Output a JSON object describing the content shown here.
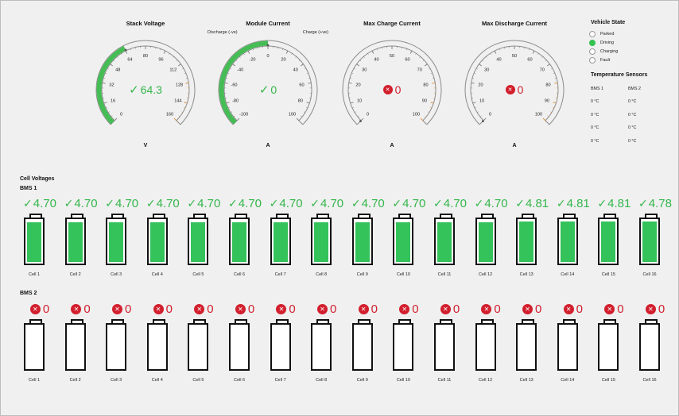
{
  "gauges": [
    {
      "key": "stack",
      "title": "Stack Voltage",
      "unit": "V",
      "min": 0,
      "max": 160,
      "ticks": [
        0,
        16,
        32,
        48,
        64,
        80,
        96,
        112,
        128,
        144,
        160
      ],
      "value": 64.3,
      "value_text": "64.3",
      "status": "ok",
      "sub_left": "",
      "sub_right": ""
    },
    {
      "key": "module",
      "title": "Module Current",
      "unit": "A",
      "min": -100,
      "max": 100,
      "ticks": [
        -100,
        -80,
        -60,
        -40,
        -20,
        0,
        20,
        40,
        60,
        80,
        100
      ],
      "value": 0,
      "value_text": "0",
      "status": "ok",
      "sub_left": "Discharge (-ve)",
      "sub_right": "Charge (+ve)"
    },
    {
      "key": "maxcharge",
      "title": "Max Charge Current",
      "unit": "A",
      "min": 0,
      "max": 100,
      "ticks": [
        0,
        10,
        20,
        30,
        40,
        50,
        60,
        70,
        80,
        90,
        100
      ],
      "value": 0,
      "value_text": "0",
      "status": "error",
      "sub_left": "",
      "sub_right": ""
    },
    {
      "key": "maxdischarge",
      "title": "Max Discharge Current",
      "unit": "A",
      "min": 0,
      "max": 100,
      "ticks": [
        0,
        10,
        20,
        30,
        40,
        50,
        60,
        70,
        80,
        90,
        100
      ],
      "value": 0,
      "value_text": "0",
      "status": "error",
      "sub_left": "",
      "sub_right": ""
    }
  ],
  "vehicle_state": {
    "title": "Vehicle State",
    "options": [
      {
        "label": "Parked",
        "selected": false
      },
      {
        "label": "Driving",
        "selected": true
      },
      {
        "label": "Charging",
        "selected": false
      },
      {
        "label": "Fault",
        "selected": false
      }
    ]
  },
  "temperature": {
    "title": "Temperature Sensors",
    "headers": [
      "BMS 1",
      "BMS 2"
    ],
    "rows": [
      [
        "0 °C",
        "0 °C"
      ],
      [
        "0 °C",
        "0 °C"
      ],
      [
        "0 °C",
        "0 °C"
      ],
      [
        "0 °C",
        "0 °C"
      ]
    ]
  },
  "cell_voltages_title": "Cell Voltages",
  "bms": [
    {
      "title": "BMS 1",
      "status": "ok",
      "max_voltage": 4.9,
      "cells": [
        {
          "label": "Cell 1",
          "value": "4.70"
        },
        {
          "label": "Cell 2",
          "value": "4.70"
        },
        {
          "label": "Cell 3",
          "value": "4.70"
        },
        {
          "label": "Cell 4",
          "value": "4.70"
        },
        {
          "label": "Cell 5",
          "value": "4.70"
        },
        {
          "label": "Cell 6",
          "value": "4.70"
        },
        {
          "label": "Cell 7",
          "value": "4.70"
        },
        {
          "label": "Cell 8",
          "value": "4.70"
        },
        {
          "label": "Cell 9",
          "value": "4.70"
        },
        {
          "label": "Cell 10",
          "value": "4.70"
        },
        {
          "label": "Cell 11",
          "value": "4.70"
        },
        {
          "label": "Cell 12",
          "value": "4.70"
        },
        {
          "label": "Cell 13",
          "value": "4.81"
        },
        {
          "label": "Cell 14",
          "value": "4.81"
        },
        {
          "label": "Cell 15",
          "value": "4.81"
        },
        {
          "label": "Cell 16",
          "value": "4.78"
        }
      ]
    },
    {
      "title": "BMS 2",
      "status": "error",
      "max_voltage": 4.9,
      "cells": [
        {
          "label": "Cell 1",
          "value": "0"
        },
        {
          "label": "Cell 2",
          "value": "0"
        },
        {
          "label": "Cell 3",
          "value": "0"
        },
        {
          "label": "Cell 4",
          "value": "0"
        },
        {
          "label": "Cell 5",
          "value": "0"
        },
        {
          "label": "Cell 6",
          "value": "0"
        },
        {
          "label": "Cell 7",
          "value": "0"
        },
        {
          "label": "Cell 8",
          "value": "0"
        },
        {
          "label": "Cell 9",
          "value": "0"
        },
        {
          "label": "Cell 10",
          "value": "0"
        },
        {
          "label": "Cell 11",
          "value": "0"
        },
        {
          "label": "Cell 12",
          "value": "0"
        },
        {
          "label": "Cell 13",
          "value": "0"
        },
        {
          "label": "Cell 14",
          "value": "0"
        },
        {
          "label": "Cell 15",
          "value": "0"
        },
        {
          "label": "Cell 16",
          "value": "0"
        }
      ]
    }
  ],
  "colors": {
    "ok": "#34b64b",
    "error": "#d21f2d",
    "gauge_fill": "#45bd55",
    "warning_ticks": "#d98a2a"
  }
}
